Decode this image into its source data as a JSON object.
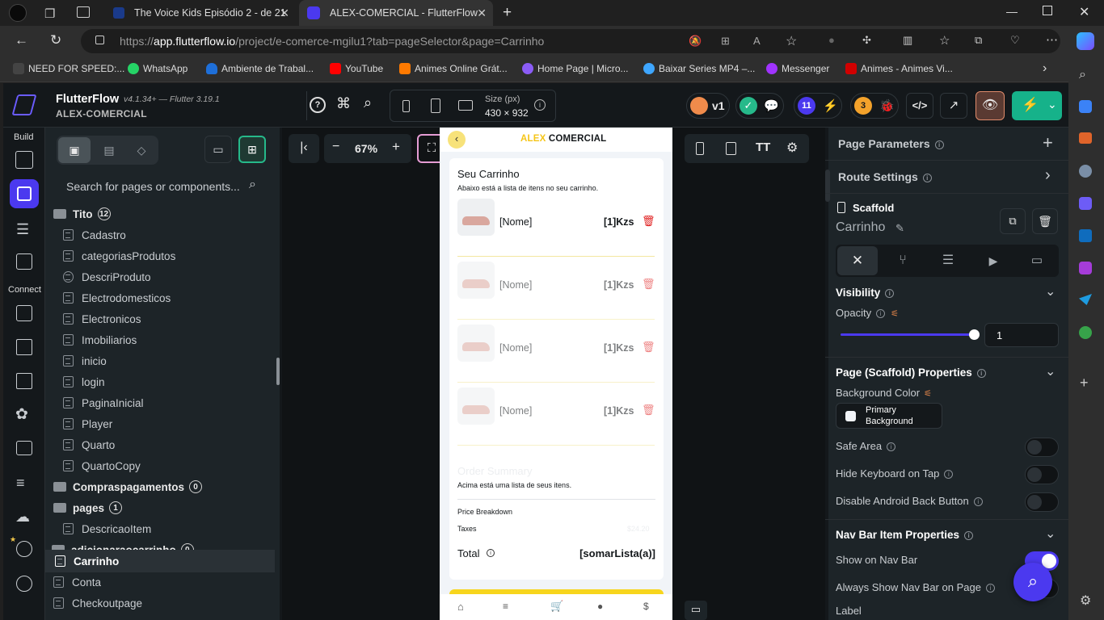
{
  "browser": {
    "tabs": [
      {
        "title": "The Voice Kids Episódio 2 - de 21"
      },
      {
        "title": "ALEX-COMERCIAL - FlutterFlow"
      }
    ],
    "url_prefix": "https://",
    "url_domain": "app.flutterflow.io",
    "url_path": "/project/e-comerce-mgilu1?tab=pageSelector&page=Carrinho",
    "bookmarks": [
      {
        "label": "NEED FOR SPEED:...",
        "color": "#444"
      },
      {
        "label": "WhatsApp",
        "color": "#25d366"
      },
      {
        "label": "Ambiente de Trabal...",
        "color": "#1e6fd9"
      },
      {
        "label": "YouTube",
        "color": "#ff0000"
      },
      {
        "label": "Animes Online Grát...",
        "color": "#ff7a00"
      },
      {
        "label": "Home Page | Micro...",
        "color": "#8b5cf6"
      },
      {
        "label": "Baixar Series MP4 –...",
        "color": "#3ea6ff"
      },
      {
        "label": "Messenger",
        "color": "#a033ff"
      },
      {
        "label": "Animes - Animes Vi...",
        "color": "#d10000"
      }
    ]
  },
  "app": {
    "name": "FlutterFlow",
    "version": "v4.1.34+ — Flutter 3.19.1",
    "project": "ALEX-COMERCIAL",
    "size_label": "Size (px)",
    "size_value": "430 × 932",
    "branch": "v1",
    "badge_issues": "11",
    "badge_warn": "3",
    "zoom": "67%"
  },
  "rail": {
    "build": "Build",
    "connect": "Connect"
  },
  "nav": {
    "search_placeholder": "Search for pages or components...",
    "folder_tito": "Tito",
    "tito_count": "12",
    "tito_pages": [
      "Cadastro",
      "categoriasProdutos",
      "DescriProduto",
      "Electrodomesticos",
      "Electronicos",
      "Imobiliarios",
      "inicio",
      "login",
      "PaginaInicial",
      "Player",
      "Quarto",
      "QuartoCopy"
    ],
    "folder_compras": "Compraspagamentos",
    "compras_count": "0",
    "folder_pages": "pages",
    "pages_count": "1",
    "pages_items": [
      "DescricaoItem"
    ],
    "folder_add": "adicionaraocarrinho",
    "add_count": "0",
    "root_pages": [
      "Carrinho",
      "Conta",
      "Checkoutpage"
    ]
  },
  "phone": {
    "brand_a": "ALEX",
    "brand_b": " COMERCIAL",
    "title": "Seu Carrinho",
    "subtitle": "Abaixo está a lista de itens no seu carrinho.",
    "items": [
      {
        "name": "[Nome]",
        "price": "[1]Kzs"
      },
      {
        "name": "[Nome]",
        "price": "[1]Kzs"
      },
      {
        "name": "[Nome]",
        "price": "[1]Kzs"
      },
      {
        "name": "[Nome]",
        "price": "[1]Kzs"
      }
    ],
    "order_summary": "Order Summary",
    "summary_note": "Acima está uma lista de seus itens.",
    "price_breakdown": "Price Breakdown",
    "taxes": "Taxes",
    "taxes_value": "$24.20",
    "total": "Total",
    "total_value": "[somarLista(a)]"
  },
  "props": {
    "page_parameters": "Page Parameters",
    "route_settings": "Route Settings",
    "scaffold": "Scaffold",
    "page_name": "Carrinho",
    "visibility": "Visibility",
    "opacity": "Opacity",
    "opacity_value": "1",
    "opacity_level": 1,
    "page_props": "Page (Scaffold) Properties",
    "bg_color": "Background Color",
    "bg_value_1": "Primary",
    "bg_value_2": "Background",
    "safe_area": "Safe Area",
    "hide_keyboard": "Hide Keyboard on Tap",
    "disable_back": "Disable Android Back Button",
    "nav_bar_props": "Nav Bar Item Properties",
    "show_nav": "Show on Nav Bar",
    "always_show": "Always Show Nav Bar on Page",
    "label": "Label"
  }
}
